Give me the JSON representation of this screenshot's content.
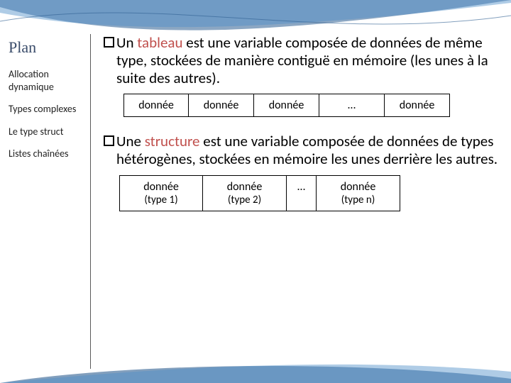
{
  "accent_blue": "#3a4c6a",
  "accent_red": "#c0504d",
  "sidebar": {
    "title": "Plan",
    "items": [
      "Allocation dynamique",
      "Types complexes",
      "Le type struct",
      "Listes chaînées"
    ]
  },
  "para1": {
    "pre": "Un ",
    "hl": "tableau",
    "post": " est une variable composée de données de même type, stockées de manière contiguë en mémoire (les unes à la suite des autres)."
  },
  "row1": [
    "donnée",
    "donnée",
    "donnée",
    "…",
    "donnée"
  ],
  "para2": {
    "pre": "Une ",
    "hl": "structure",
    "post": " est une variable composée de données de types hétérogènes, stockées en mémoire les unes derrière les autres."
  },
  "row2": [
    {
      "t": "donnée",
      "s": "(type 1)"
    },
    {
      "t": "donnée",
      "s": "(type 2)"
    },
    {
      "t": "…",
      "s": ""
    },
    {
      "t": "donnée",
      "s": "(type n)"
    }
  ]
}
